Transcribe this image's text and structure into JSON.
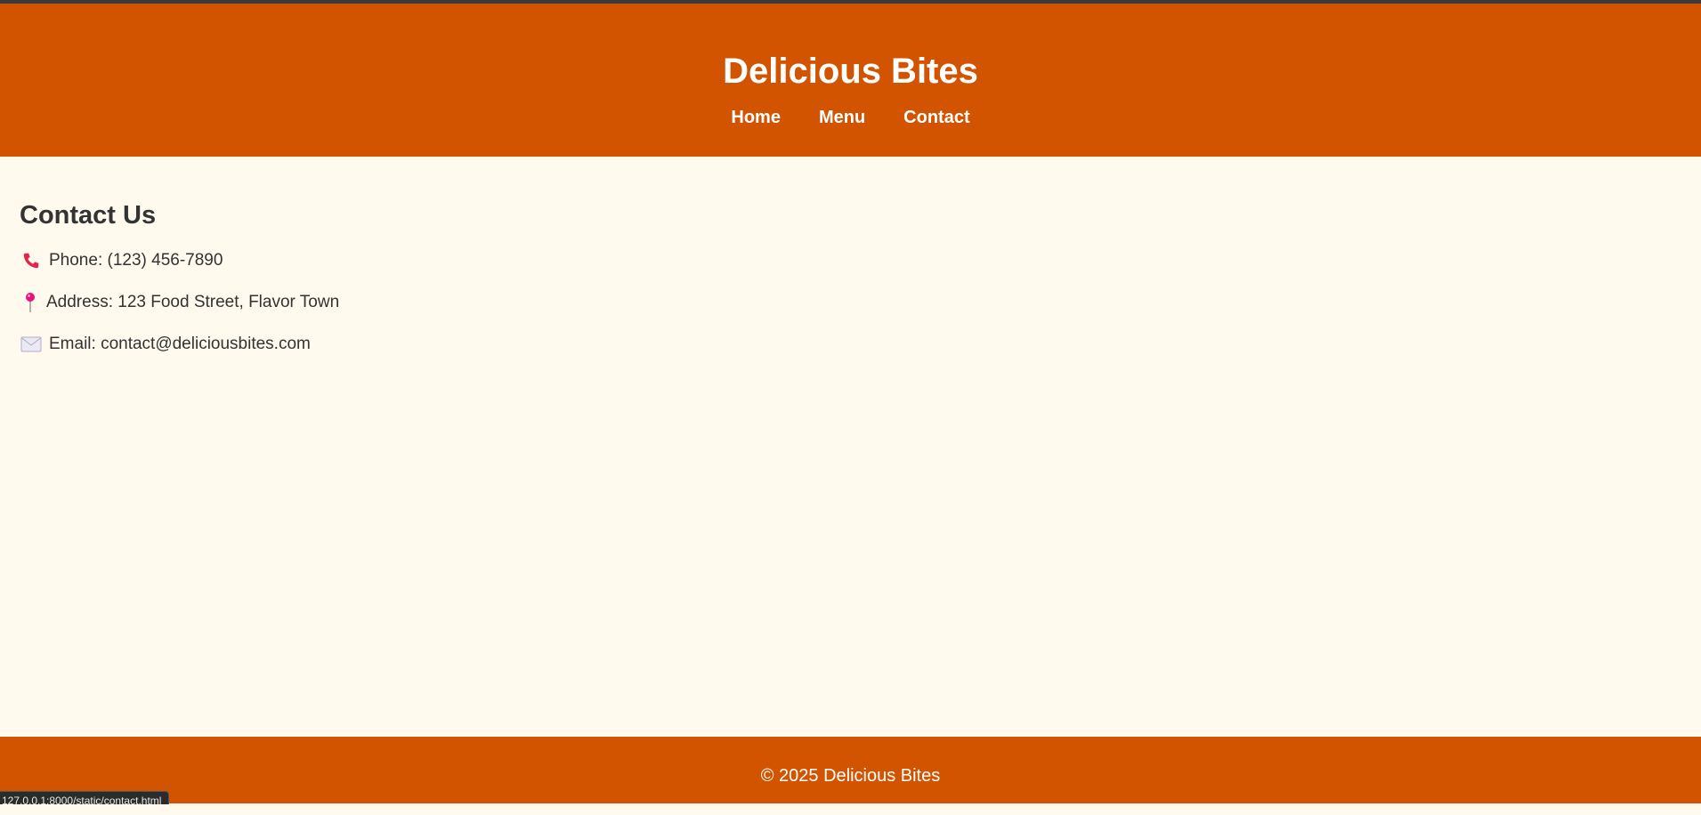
{
  "header": {
    "title": "Delicious Bites",
    "nav": [
      "Home",
      "Menu",
      "Contact"
    ]
  },
  "main": {
    "heading": "Contact Us",
    "items": [
      {
        "icon": "phone-icon",
        "text": "Phone: (123) 456-7890"
      },
      {
        "icon": "pushpin-icon",
        "text": "Address: 123 Food Street, Flavor Town"
      },
      {
        "icon": "envelope-icon",
        "text": "Email: contact@deliciousbites.com"
      }
    ]
  },
  "footer": {
    "text": "© 2025 Delicious Bites"
  },
  "status_bar": {
    "url": "127.0.0.1:8000/static/contact.html"
  },
  "colors": {
    "brand": "#d35400",
    "background": "#fff9ee",
    "text": "#333333"
  }
}
